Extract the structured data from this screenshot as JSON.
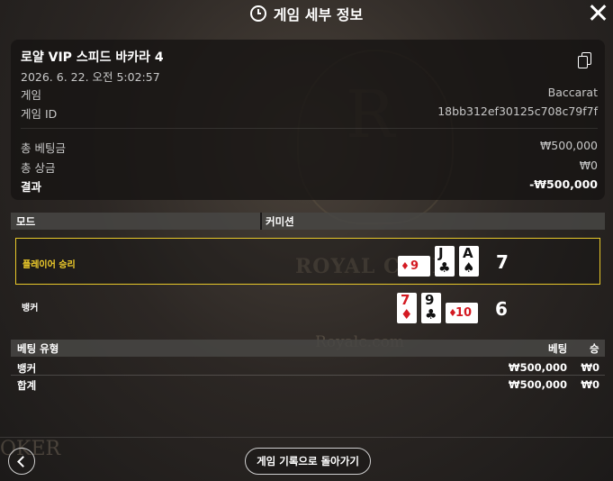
{
  "header": {
    "title": "게임 세부 정보",
    "icon": "history-clock-icon",
    "close_icon": "close-icon"
  },
  "info": {
    "game_name": "로얄 VIP 스피드 바카라 4",
    "datetime": "2026. 6. 22. 오전 5:02:57",
    "game_label": "게임",
    "game_value": "Baccarat",
    "id_label": "게임 ID",
    "id_value": "18bb312ef30125c708c79f7f",
    "total_bet_label": "총 베팅금",
    "total_bet_value": "₩500,000",
    "total_win_label": "총 상금",
    "total_win_value": "₩0",
    "result_label": "결과",
    "result_value": "-₩500,000",
    "copy_icon": "copy-icon"
  },
  "mode_header": {
    "col1": "모드",
    "col2": "커미션"
  },
  "results": {
    "player": {
      "label": "플레이어 승리",
      "score": "7",
      "cards": [
        {
          "rank": "9",
          "suit": "♦",
          "color": "#d41a22",
          "orientation": "sideways"
        },
        {
          "rank": "J",
          "suit": "♣",
          "color": "#111111",
          "orientation": "upright"
        },
        {
          "rank": "A",
          "suit": "♠",
          "color": "#111111",
          "orientation": "upright"
        }
      ]
    },
    "banker": {
      "label": "뱅커",
      "score": "6",
      "cards": [
        {
          "rank": "7",
          "suit": "♦",
          "color": "#d41a22",
          "orientation": "upright"
        },
        {
          "rank": "9",
          "suit": "♣",
          "color": "#111111",
          "orientation": "upright"
        },
        {
          "rank": "10",
          "suit": "♦",
          "color": "#d41a22",
          "orientation": "sideways"
        }
      ]
    }
  },
  "bets": {
    "headers": {
      "type": "베팅 유형",
      "bet": "베팅",
      "win": "승"
    },
    "rows": [
      {
        "type": "뱅커",
        "bet": "₩500,000",
        "win": "₩0"
      },
      {
        "type": "합계",
        "bet": "₩500,000",
        "win": "₩0"
      }
    ]
  },
  "footer": {
    "history_button": "게임 기록으로 돌아가기",
    "back_icon": "chevron-left-icon"
  },
  "colors": {
    "accent_gold": "#f4d02b",
    "card_red": "#d41a22"
  }
}
